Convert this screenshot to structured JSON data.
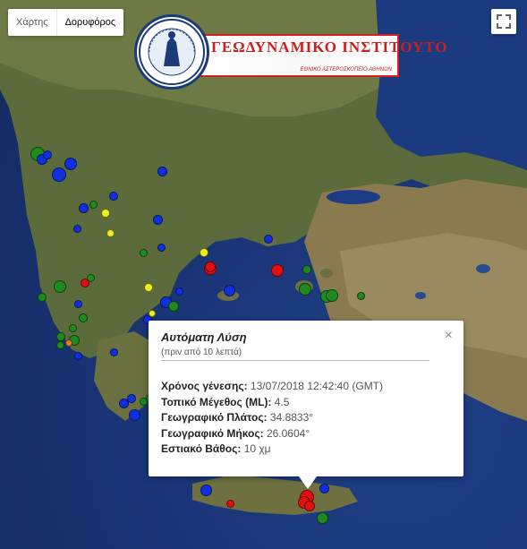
{
  "map_type": {
    "options": [
      "Χάρτης",
      "Δορυφόρος"
    ],
    "active": "Δορυφόρος"
  },
  "fullscreen": {
    "icon": "fullscreen-icon"
  },
  "logo": {
    "title": "ΓΕΩΔΥΝΑΜΙΚΟ ΙΝΣΤΙΤΟΥΤΟ",
    "subtitle": "ΕΘΝΙΚΟ ΑΣΤΕΡΟΣΚΟΠΕΙΟ ΑΘΗΝΩΝ",
    "seal": "seal-icon"
  },
  "popup": {
    "title": "Αυτόματη Λύση",
    "subtitle": "(πριν από 10 λεπτά)",
    "close": "×",
    "rows": [
      {
        "label": "Χρόνος γένεσης:",
        "value": "13/07/2018  12:42:40 (GMT)"
      },
      {
        "label": "Τοπικό Μέγεθος (ML):",
        "value": "4.5"
      },
      {
        "label": "Γεωγραφικό Πλάτος:",
        "value": "34.8833°"
      },
      {
        "label": "Γεωγραφικό Μήκος:",
        "value": "26.0604°"
      },
      {
        "label": "Εστιακό Βάθος:",
        "value": "10 χμ"
      }
    ]
  },
  "colors": {
    "blue": "#1030e0",
    "green": "#1f8a1f",
    "red": "#e01010",
    "yellow": "#f0f020",
    "orange": "#e08020"
  }
}
